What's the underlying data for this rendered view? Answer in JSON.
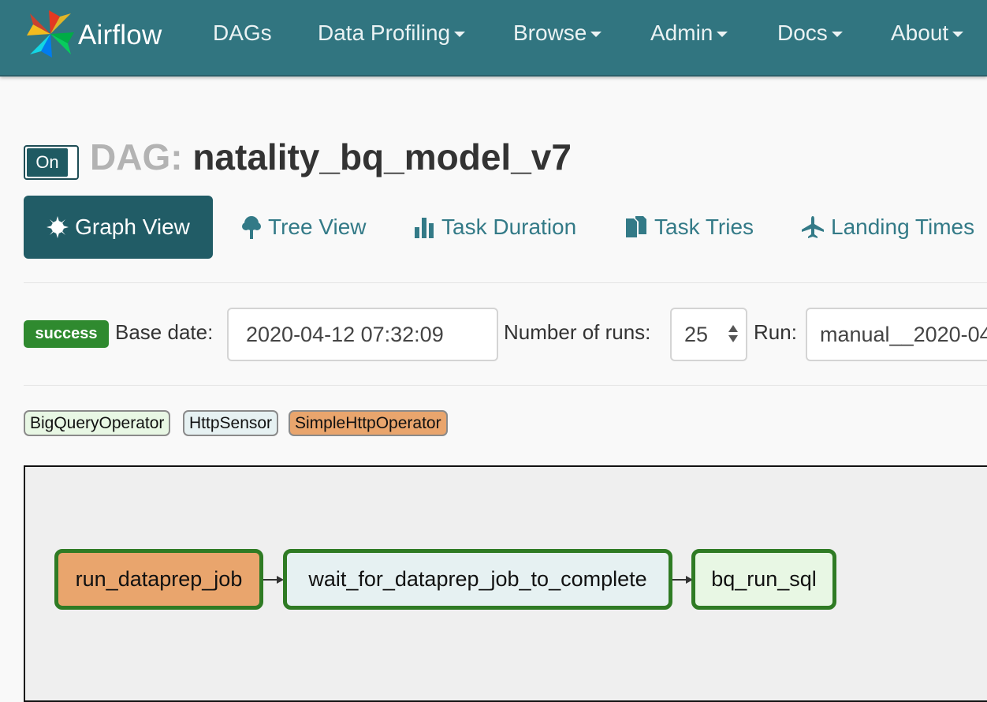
{
  "navbar": {
    "brand": "Airflow",
    "items": [
      {
        "label": "DAGs",
        "dropdown": false
      },
      {
        "label": "Data Profiling",
        "dropdown": true
      },
      {
        "label": "Browse",
        "dropdown": true
      },
      {
        "label": "Admin",
        "dropdown": true
      },
      {
        "label": "Docs",
        "dropdown": true
      },
      {
        "label": "About",
        "dropdown": true
      }
    ]
  },
  "dag": {
    "toggle_label": "On",
    "title_prefix": "DAG:",
    "name": "natality_bq_model_v7"
  },
  "tabs": [
    {
      "label": "Graph View",
      "icon": "asterisk-icon",
      "active": true
    },
    {
      "label": "Tree View",
      "icon": "tree-icon",
      "active": false
    },
    {
      "label": "Task Duration",
      "icon": "bar-chart-icon",
      "active": false
    },
    {
      "label": "Task Tries",
      "icon": "files-icon",
      "active": false
    },
    {
      "label": "Landing Times",
      "icon": "plane-icon",
      "active": false
    }
  ],
  "controls": {
    "status": "success",
    "base_date_label": "Base date:",
    "base_date_value": "2020-04-12 07:32:09",
    "num_runs_label": "Number of runs:",
    "num_runs_value": "25",
    "run_label": "Run:",
    "run_value": "manual__2020-04"
  },
  "legend": [
    {
      "label": "BigQueryOperator",
      "color": "#e8f7e4"
    },
    {
      "label": "HttpSensor",
      "color": "#e6f1f2"
    },
    {
      "label": "SimpleHttpOperator",
      "color": "#e9a56d"
    }
  ],
  "graph": {
    "nodes": [
      {
        "label": "run_dataprep_job",
        "color": "#e9a56d",
        "state_color": "#2f7b24"
      },
      {
        "label": "wait_for_dataprep_job_to_complete",
        "color": "#e6f1f2",
        "state_color": "#2f7b24"
      },
      {
        "label": "bq_run_sql",
        "color": "#e8f7e4",
        "state_color": "#2f7b24"
      }
    ]
  },
  "colors": {
    "navbar": "#317580",
    "active_tab": "#215c66",
    "link": "#337a87",
    "success": "#2f8a2f"
  }
}
